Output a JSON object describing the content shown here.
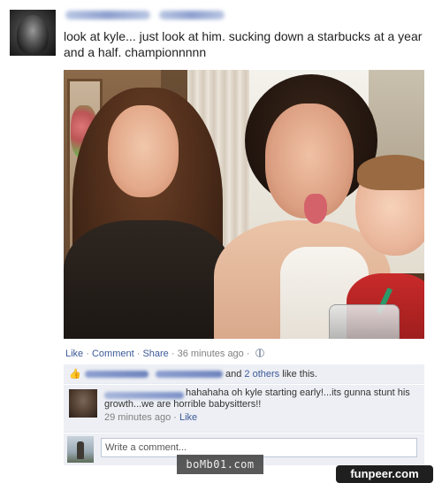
{
  "post": {
    "status_text": "look at kyle... just look at him. sucking down a starbucks at a year and a half. championnnnn",
    "actions": {
      "like": "Like",
      "comment": "Comment",
      "share": "Share",
      "separator": " · ",
      "time": "36 minutes ago"
    },
    "likes": {
      "text_mid": "and ",
      "others_link": "2 others",
      "text_end": " like this."
    }
  },
  "comment": {
    "text": "hahahaha oh kyle starting early!...its gunna stunt his growth...we are horrible babysitters!!",
    "time": "29 minutes ago",
    "separator": " · ",
    "like": "Like"
  },
  "write_comment": {
    "placeholder": "Write a comment..."
  },
  "watermarks": {
    "left": "boMb01.com",
    "right": "funpeer.com"
  },
  "colors": {
    "link": "#3b5998",
    "meta": "#7f7f7f",
    "panel": "#edeff4",
    "input_border": "#bdc7d8"
  },
  "icons": {
    "like": "thumbs-up-icon",
    "privacy": "globe-icon"
  }
}
